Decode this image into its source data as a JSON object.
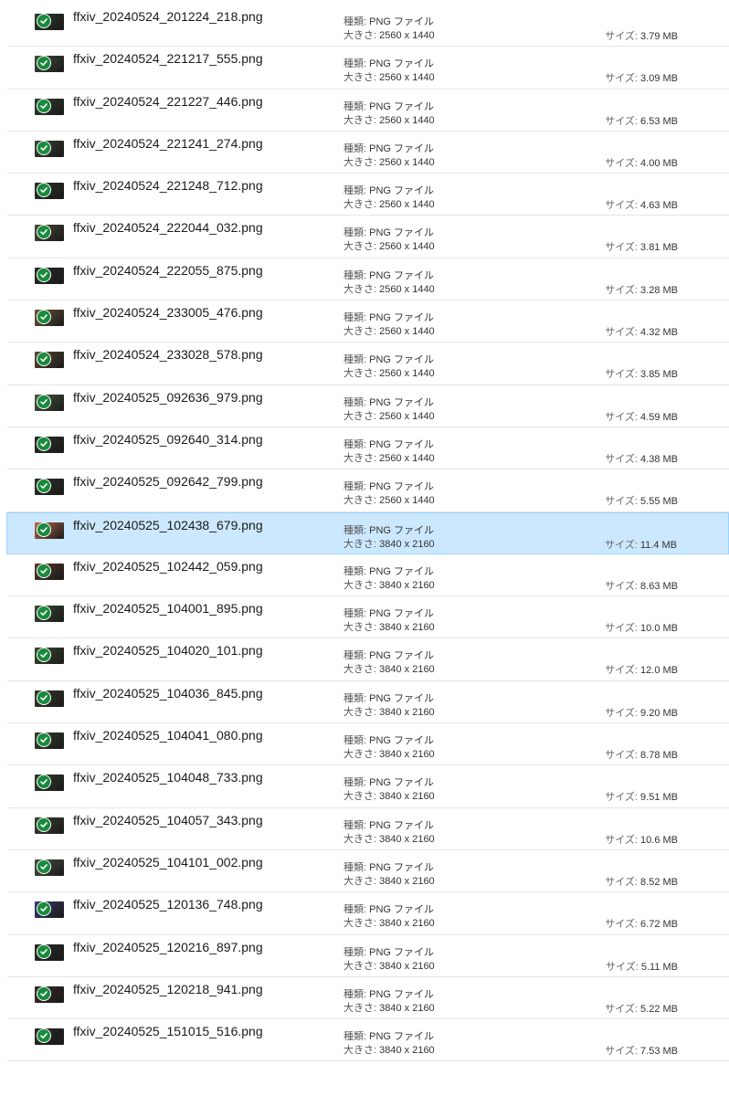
{
  "labels": {
    "type_label": "種類:",
    "dims_label": "大きさ:",
    "size_label": "サイズ:"
  },
  "colors": {
    "selected_bg": "#cce8ff",
    "selected_border": "#99d1ff",
    "sync_green": "#1a8a3c"
  },
  "files": [
    {
      "name": "ffxiv_20240524_201224_218.png",
      "type": "PNG ファイル",
      "dims": "2560 x 1440",
      "size": "3.79 MB",
      "thumb": "#2b3a2c",
      "selected": false
    },
    {
      "name": "ffxiv_20240524_221217_555.png",
      "type": "PNG ファイル",
      "dims": "2560 x 1440",
      "size": "3.09 MB",
      "thumb": "#3a4a3a",
      "selected": false
    },
    {
      "name": "ffxiv_20240524_221227_446.png",
      "type": "PNG ファイル",
      "dims": "2560 x 1440",
      "size": "6.53 MB",
      "thumb": "#2f3f2e",
      "selected": false
    },
    {
      "name": "ffxiv_20240524_221241_274.png",
      "type": "PNG ファイル",
      "dims": "2560 x 1440",
      "size": "4.00 MB",
      "thumb": "#3b4236",
      "selected": false
    },
    {
      "name": "ffxiv_20240524_221248_712.png",
      "type": "PNG ファイル",
      "dims": "2560 x 1440",
      "size": "4.63 MB",
      "thumb": "#2a302a",
      "selected": false
    },
    {
      "name": "ffxiv_20240524_222044_032.png",
      "type": "PNG ファイル",
      "dims": "2560 x 1440",
      "size": "3.81 MB",
      "thumb": "#4a4838",
      "selected": false
    },
    {
      "name": "ffxiv_20240524_222055_875.png",
      "type": "PNG ファイル",
      "dims": "2560 x 1440",
      "size": "3.28 MB",
      "thumb": "#2c2c2c",
      "selected": false
    },
    {
      "name": "ffxiv_20240524_233005_476.png",
      "type": "PNG ファイル",
      "dims": "2560 x 1440",
      "size": "4.32 MB",
      "thumb": "#6a5a3c",
      "selected": false
    },
    {
      "name": "ffxiv_20240524_233028_578.png",
      "type": "PNG ファイル",
      "dims": "2560 x 1440",
      "size": "3.85 MB",
      "thumb": "#5a4a34",
      "selected": false
    },
    {
      "name": "ffxiv_20240525_092636_979.png",
      "type": "PNG ファイル",
      "dims": "2560 x 1440",
      "size": "4.59 MB",
      "thumb": "#4a5a48",
      "selected": false
    },
    {
      "name": "ffxiv_20240525_092640_314.png",
      "type": "PNG ファイル",
      "dims": "2560 x 1440",
      "size": "4.38 MB",
      "thumb": "#2a3028",
      "selected": false
    },
    {
      "name": "ffxiv_20240525_092642_799.png",
      "type": "PNG ファイル",
      "dims": "2560 x 1440",
      "size": "5.55 MB",
      "thumb": "#283428",
      "selected": false
    },
    {
      "name": "ffxiv_20240525_102438_679.png",
      "type": "PNG ファイル",
      "dims": "3840 x 2160",
      "size": "11.4 MB",
      "thumb": "#b86a4a",
      "selected": true
    },
    {
      "name": "ffxiv_20240525_102442_059.png",
      "type": "PNG ファイル",
      "dims": "3840 x 2160",
      "size": "8.63 MB",
      "thumb": "#5a3a2a",
      "selected": false
    },
    {
      "name": "ffxiv_20240525_104001_895.png",
      "type": "PNG ファイル",
      "dims": "3840 x 2160",
      "size": "10.0 MB",
      "thumb": "#3a4a34",
      "selected": false
    },
    {
      "name": "ffxiv_20240525_104020_101.png",
      "type": "PNG ファイル",
      "dims": "3840 x 2160",
      "size": "12.0 MB",
      "thumb": "#3c4a2c",
      "selected": false
    },
    {
      "name": "ffxiv_20240525_104036_845.png",
      "type": "PNG ファイル",
      "dims": "3840 x 2160",
      "size": "9.20 MB",
      "thumb": "#3a3a30",
      "selected": false
    },
    {
      "name": "ffxiv_20240525_104041_080.png",
      "type": "PNG ファイル",
      "dims": "3840 x 2160",
      "size": "8.78 MB",
      "thumb": "#344030",
      "selected": false
    },
    {
      "name": "ffxiv_20240525_104048_733.png",
      "type": "PNG ファイル",
      "dims": "3840 x 2160",
      "size": "9.51 MB",
      "thumb": "#2e3a2a",
      "selected": false
    },
    {
      "name": "ffxiv_20240525_104057_343.png",
      "type": "PNG ファイル",
      "dims": "3840 x 2160",
      "size": "10.6 MB",
      "thumb": "#3a4434",
      "selected": false
    },
    {
      "name": "ffxiv_20240525_104101_002.png",
      "type": "PNG ファイル",
      "dims": "3840 x 2160",
      "size": "8.52 MB",
      "thumb": "#4a5048",
      "selected": false
    },
    {
      "name": "ffxiv_20240525_120136_748.png",
      "type": "PNG ファイル",
      "dims": "3840 x 2160",
      "size": "6.72 MB",
      "thumb": "#3a3a6a",
      "selected": false
    },
    {
      "name": "ffxiv_20240525_120216_897.png",
      "type": "PNG ファイル",
      "dims": "3840 x 2160",
      "size": "5.11 MB",
      "thumb": "#2a2a2a",
      "selected": false
    },
    {
      "name": "ffxiv_20240525_120218_941.png",
      "type": "PNG ファイル",
      "dims": "3840 x 2160",
      "size": "5.22 MB",
      "thumb": "#3a2a2a",
      "selected": false
    },
    {
      "name": "ffxiv_20240525_151015_516.png",
      "type": "PNG ファイル",
      "dims": "3840 x 2160",
      "size": "7.53 MB",
      "thumb": "#2a2a28",
      "selected": false
    }
  ]
}
